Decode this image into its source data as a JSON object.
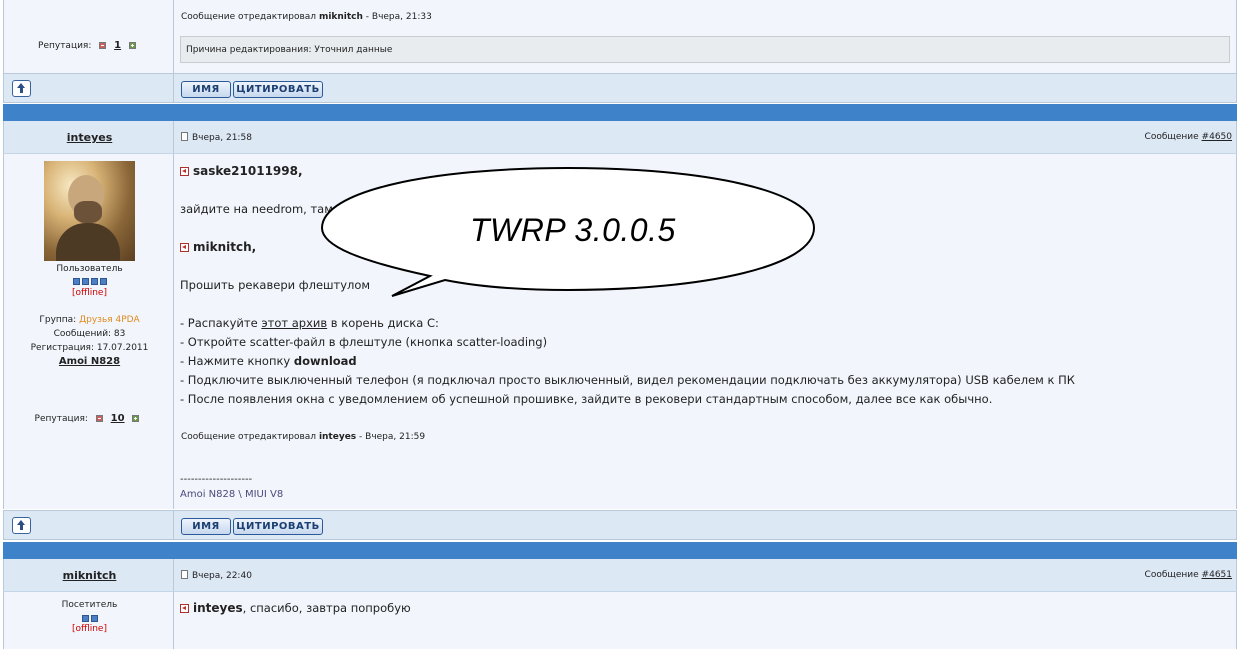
{
  "post_prev": {
    "edited_prefix": "Сообщение отредактировал",
    "edited_by": "miknitch",
    "edited_when": " - Вчера, 21:33",
    "reason": "Причина редактирования: Уточнил данные",
    "rep_label": "Репутация:",
    "rep_value": "1"
  },
  "action_bar": {
    "name_label": "ИМЯ",
    "quote_label": "ЦИТИРОВАТЬ"
  },
  "post_main": {
    "author": "inteyes",
    "date": "Вчера, 21:58",
    "msg_label": "Сообщение",
    "msg_link": "#4650",
    "role": "Пользователь",
    "status": "[offline]",
    "group_label": "Группа:",
    "group_value": "Друзья 4PDA",
    "posts": "Сообщений: 83",
    "registered": "Регистрация: 17.07.2011",
    "device": "Amoi N828",
    "rep_label": "Репутация:",
    "rep_value": "10",
    "mention1": "saske21011998,",
    "line1": "зайдите на needrom, там",
    "mention2": "miknitch,",
    "line2": "Прошить рекавери флештулом",
    "step1_pre": "- Распакуйте ",
    "step1_link": "этот архив",
    "step1_post": " в корень диска C:",
    "step2": "- Откройте scatter-файл в флештуле (кнопка scatter-loading)",
    "step3_pre": "- Нажмите кнопку ",
    "step3_bold": "download",
    "step4": "- Подключите выключенный телефон (я подключал просто выключенный, видел рекомендации подключать без аккумулятора) USB кабелем к ПК",
    "step5": "- После появления окна с уведомлением об успешной прошивке, зайдите в рековери стандартным способом, далее все как обычно.",
    "edited_prefix": "Сообщение отредактировал",
    "edited_by": "inteyes",
    "edited_when": " - Вчера, 21:59",
    "sig_line": "--------------------",
    "sig_device": "Amoi N828 \\ MIUI V8"
  },
  "bubble": {
    "text": "TWRP 3.0.0.5"
  },
  "post_next": {
    "author": "miknitch",
    "date": "Вчера, 22:40",
    "msg_label": "Сообщение",
    "msg_link": "#4651",
    "role": "Посетитель",
    "status": "[offline]",
    "mention": "inteyes",
    "text": ", спасибо, завтра попробую"
  },
  "colors": {
    "separator": "#3e83c9",
    "bar_bg": "#dde8f5",
    "post_bg": "#f2f6fc",
    "offline": "#d00000",
    "group": "#e08a1e"
  }
}
